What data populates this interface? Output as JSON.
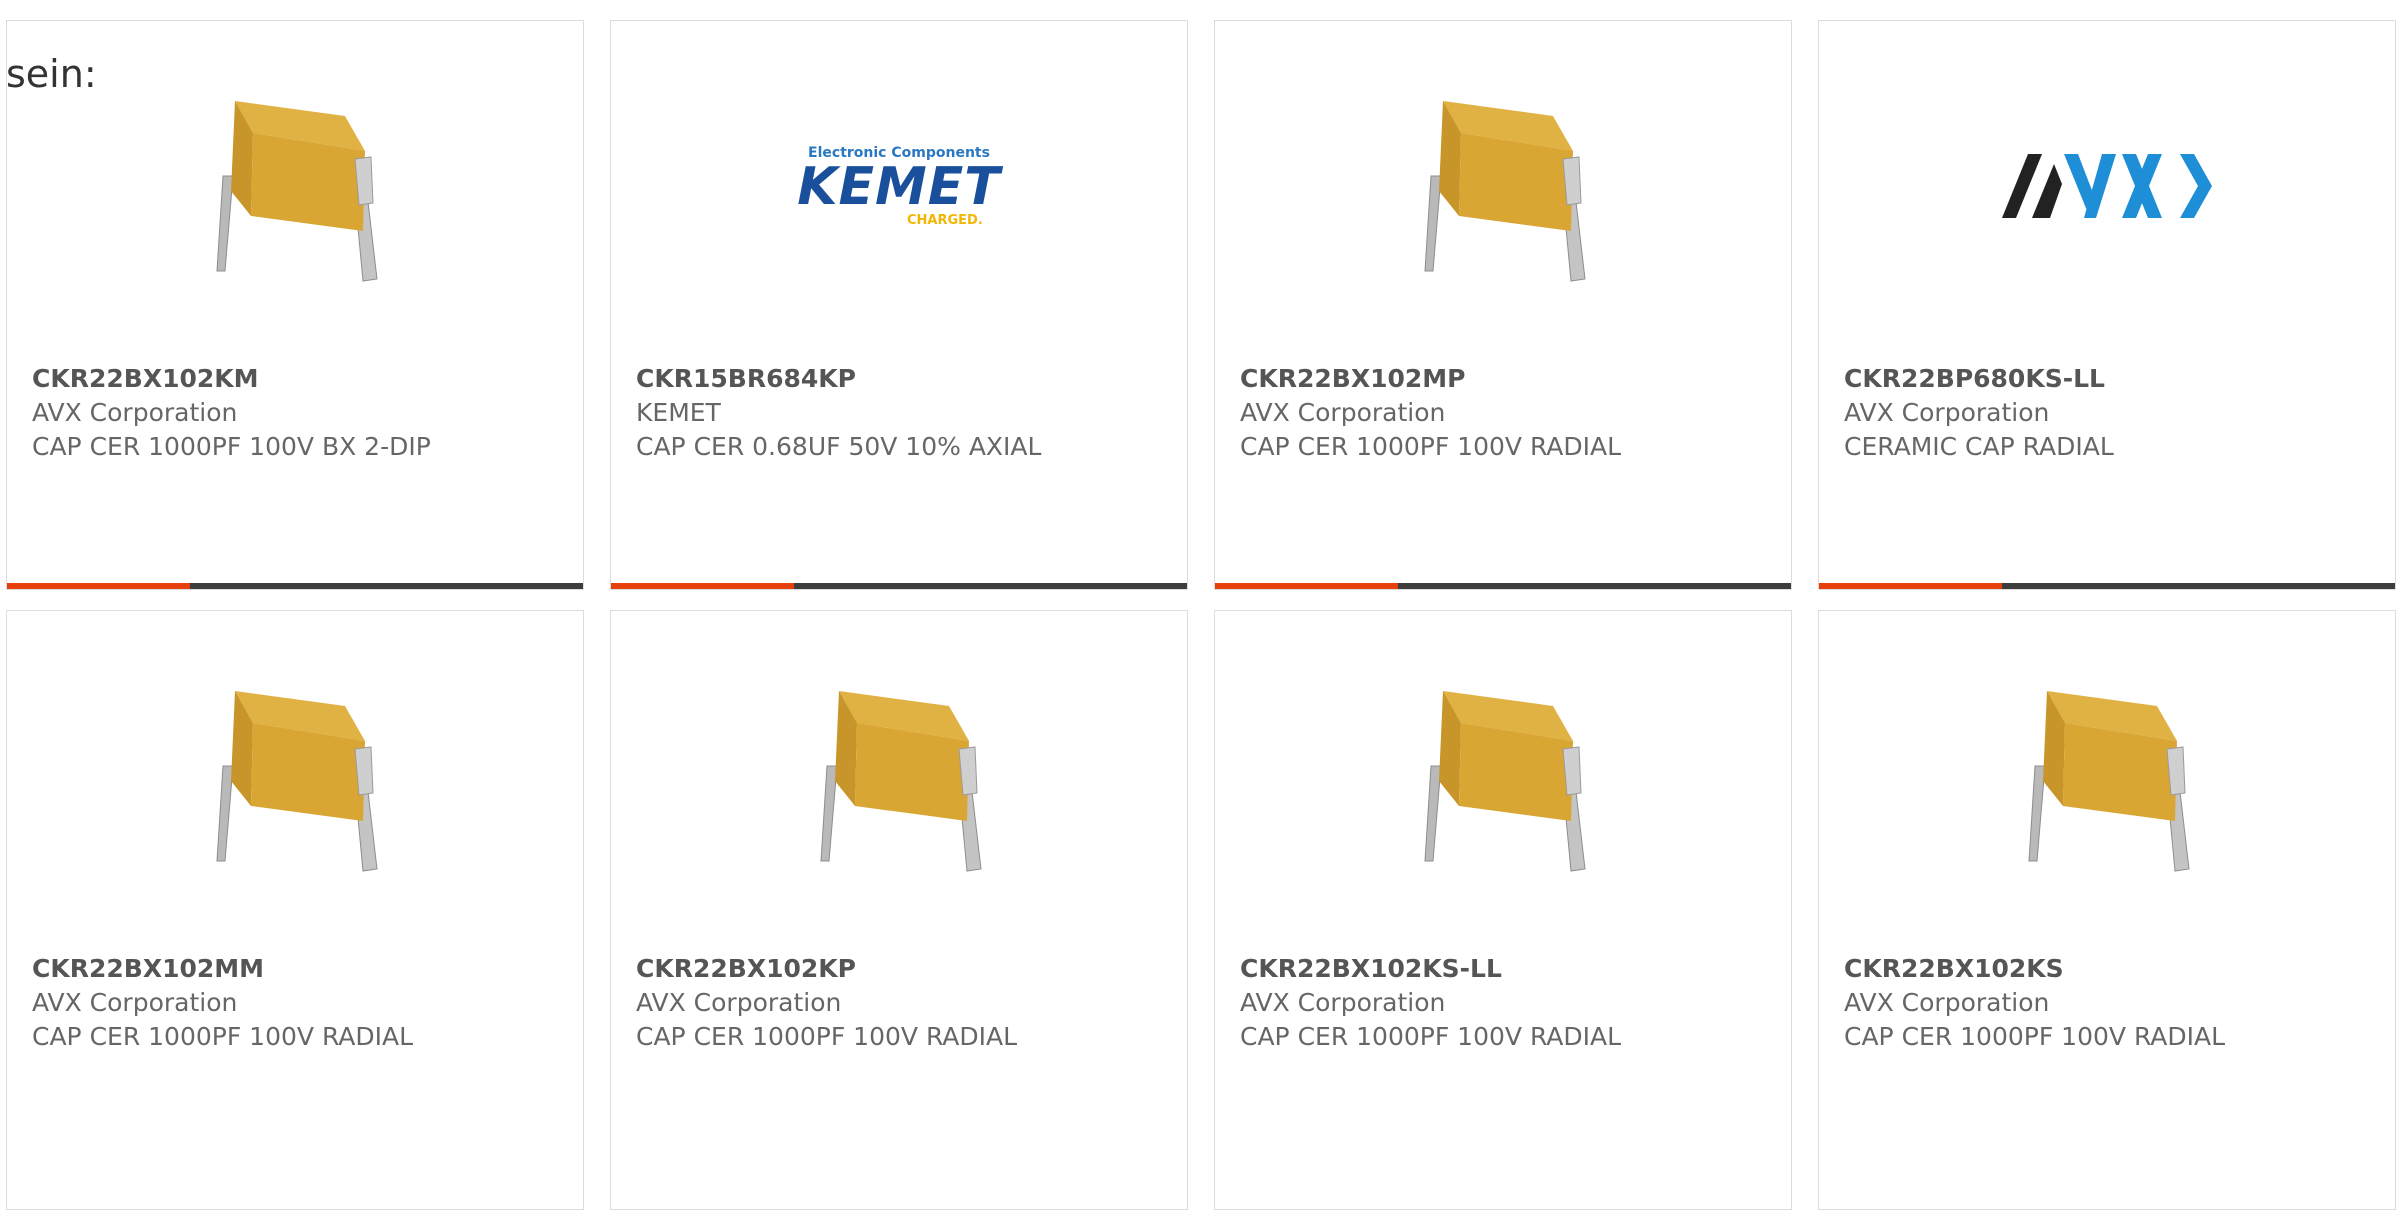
{
  "lead_text": "sein:",
  "products": [
    {
      "part": "CKR22BX102KM",
      "maker": "AVX Corporation",
      "desc": "CAP CER 1000PF 100V BX 2-DIP",
      "image": "capacitor"
    },
    {
      "part": "CKR15BR684KP",
      "maker": "KEMET",
      "desc": "CAP CER 0.68UF 50V 10% AXIAL",
      "image": "kemet-logo",
      "logo": {
        "top": "Electronic Components",
        "main": "KEMET",
        "sub": "CHARGED."
      }
    },
    {
      "part": "CKR22BX102MP",
      "maker": "AVX Corporation",
      "desc": "CAP CER 1000PF 100V RADIAL",
      "image": "capacitor"
    },
    {
      "part": "CKR22BP680KS-LL",
      "maker": "AVX Corporation",
      "desc": "CERAMIC CAP RADIAL",
      "image": "avx-logo"
    },
    {
      "part": "CKR22BX102MM",
      "maker": "AVX Corporation",
      "desc": "CAP CER 1000PF 100V RADIAL",
      "image": "capacitor"
    },
    {
      "part": "CKR22BX102KP",
      "maker": "AVX Corporation",
      "desc": "CAP CER 1000PF 100V RADIAL",
      "image": "capacitor"
    },
    {
      "part": "CKR22BX102KS-LL",
      "maker": "AVX Corporation",
      "desc": "CAP CER 1000PF 100V RADIAL",
      "image": "capacitor"
    },
    {
      "part": "CKR22BX102KS",
      "maker": "AVX Corporation",
      "desc": "CAP CER 1000PF 100V RADIAL",
      "image": "capacitor"
    }
  ],
  "colors": {
    "accent": "#e8400c",
    "bar_dark": "#3d3d3d",
    "capacitor_body": "#d9a634",
    "avx_blue": "#1e8fd6",
    "kemet_blue": "#1a4f9c",
    "kemet_yellow": "#f2b705"
  }
}
